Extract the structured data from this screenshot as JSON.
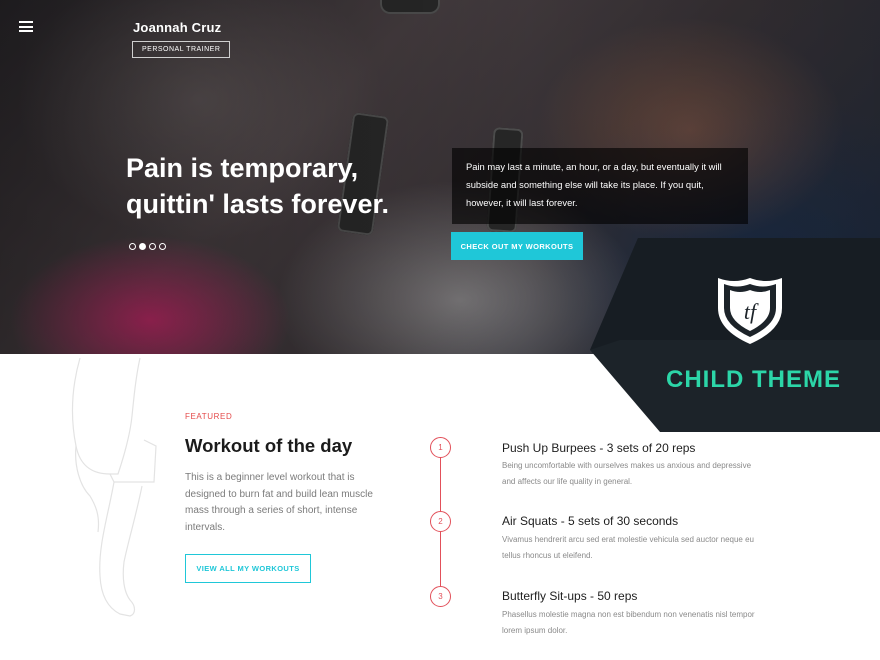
{
  "header": {
    "brand_name": "Joannah Cruz",
    "brand_tagline": "PERSONAL TRAINER",
    "menu_icon": "hamburger-icon"
  },
  "hero": {
    "title_line1": "Pain is temporary,",
    "title_line2": "quittin' lasts forever.",
    "quote": "Pain may last a minute, an hour, or a day, but eventually it will subside and something else will take its place. If you quit, however, it will last forever.",
    "cta_label": "CHECK OUT MY WORKOUTS",
    "slides": {
      "count": 4,
      "active_index": 1
    }
  },
  "overlay": {
    "logo_letters": "tf",
    "label": "CHILD THEME"
  },
  "featured": {
    "eyebrow": "FEATURED",
    "title": "Workout of the day",
    "description": "This is a beginner level workout that is designed to burn fat and build lean muscle mass through a series of short, intense intervals.",
    "button_label": "VIEW ALL MY WORKOUTS"
  },
  "workouts": [
    {
      "number": "1",
      "title": "Push Up Burpees - 3 sets of 20 reps",
      "description": "Being uncomfortable with ourselves makes us anxious and depressive and affects our life quality in general."
    },
    {
      "number": "2",
      "title": "Air Squats - 5 sets of 30 seconds",
      "description": "Vivamus hendrerit arcu sed erat molestie vehicula sed auctor neque eu tellus rhoncus ut eleifend."
    },
    {
      "number": "3",
      "title": "Butterfly Sit-ups - 50 reps",
      "description": "Phasellus molestie magna non est bibendum non venenatis nisl tempor lorem ipsum dolor."
    }
  ],
  "colors": {
    "accent_cyan": "#1fc7d8",
    "accent_red": "#e2505a",
    "child_theme_green": "#2cd6a8",
    "overlay_dark": "#1c2329"
  }
}
